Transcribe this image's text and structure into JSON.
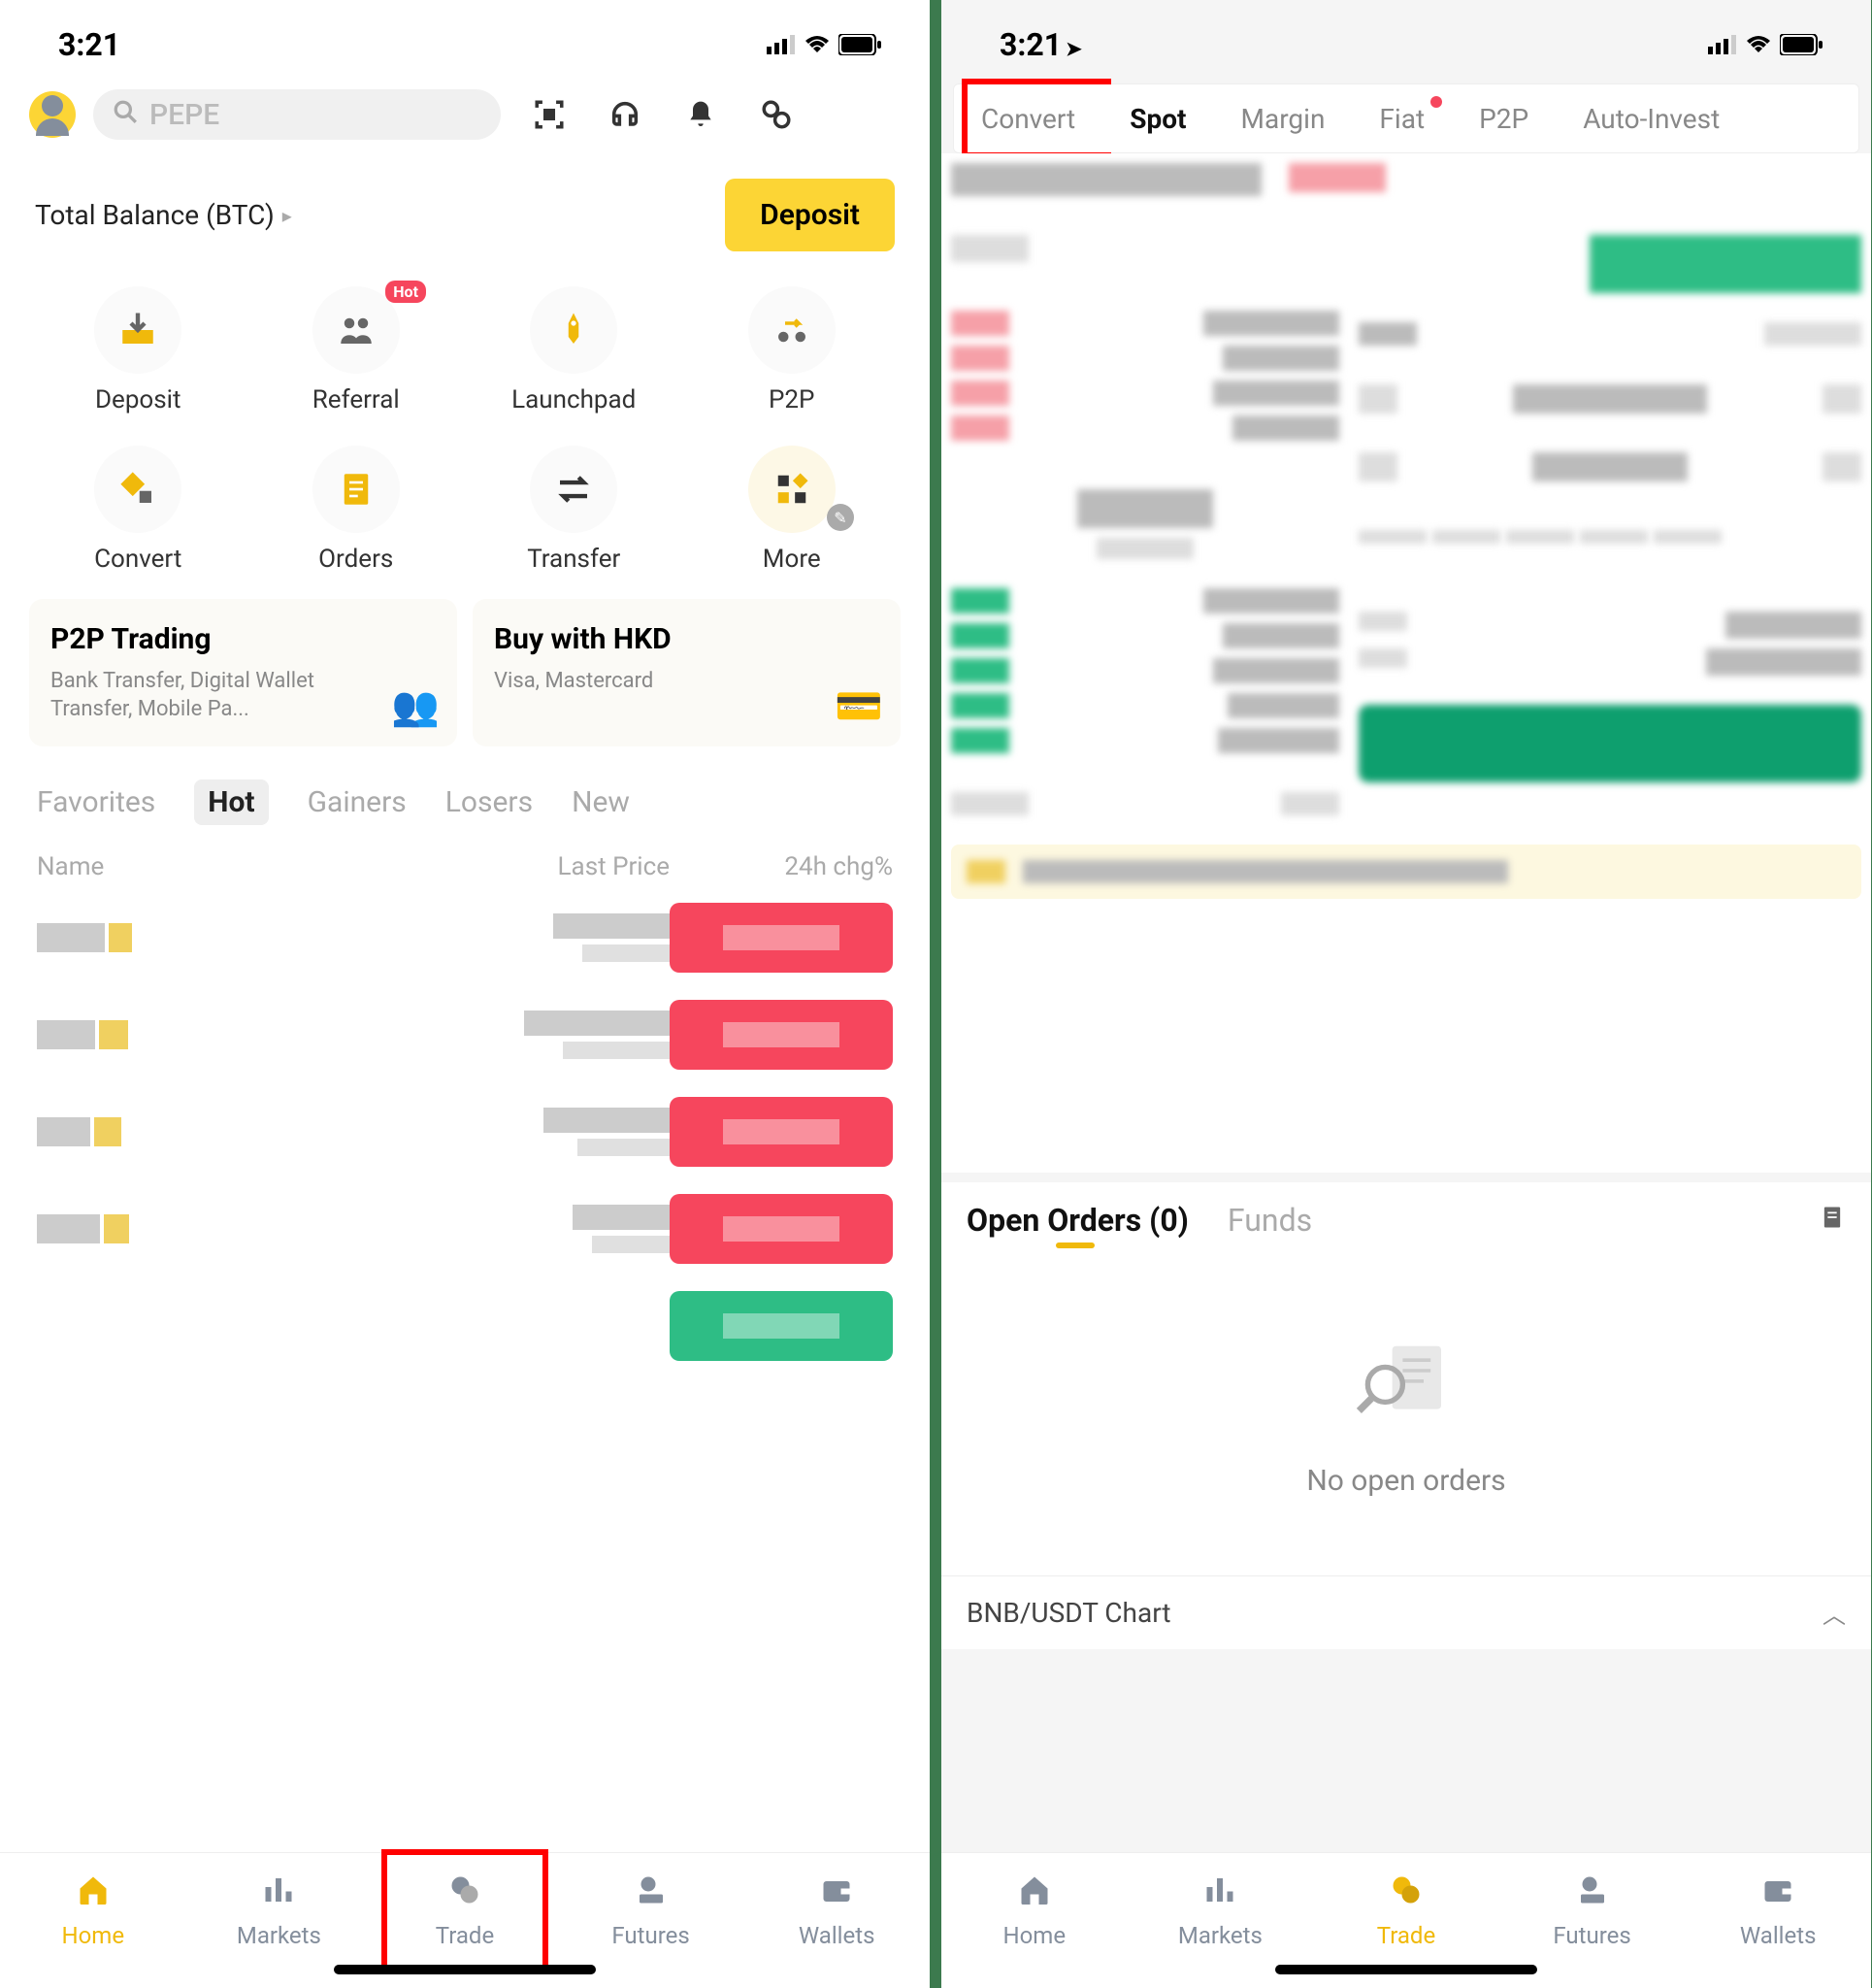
{
  "status": {
    "time": "3:21"
  },
  "left": {
    "search_placeholder": "PEPE",
    "balance_label": "Total Balance (BTC)",
    "deposit_btn": "Deposit",
    "actions": {
      "deposit": "Deposit",
      "referral": "Referral",
      "referral_badge": "Hot",
      "launchpad": "Launchpad",
      "p2p": "P2P",
      "convert": "Convert",
      "orders": "Orders",
      "transfer": "Transfer",
      "more": "More"
    },
    "cards": {
      "p2p_title": "P2P Trading",
      "p2p_sub": "Bank Transfer, Digital Wallet Transfer, Mobile Pa...",
      "buy_title": "Buy with HKD",
      "buy_sub": "Visa, Mastercard"
    },
    "market_tabs": {
      "favorites": "Favorites",
      "hot": "Hot",
      "gainers": "Gainers",
      "losers": "Losers",
      "new": "New"
    },
    "market_header": {
      "name": "Name",
      "price": "Last Price",
      "chg": "24h chg%"
    },
    "nav": {
      "home": "Home",
      "markets": "Markets",
      "trade": "Trade",
      "futures": "Futures",
      "wallets": "Wallets"
    }
  },
  "right": {
    "trade_tabs": {
      "convert": "Convert",
      "spot": "Spot",
      "margin": "Margin",
      "fiat": "Fiat",
      "p2p": "P2P",
      "autoinvest": "Auto-Invest"
    },
    "orders_tab": "Open Orders (0)",
    "funds_tab": "Funds",
    "no_orders": "No open orders",
    "chart_label": "BNB/USDT Chart",
    "nav": {
      "home": "Home",
      "markets": "Markets",
      "trade": "Trade",
      "futures": "Futures",
      "wallets": "Wallets"
    }
  }
}
